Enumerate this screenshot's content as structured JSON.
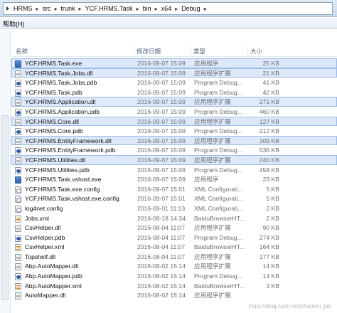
{
  "breadcrumb": [
    "HRMS",
    "src",
    "trunk",
    "YCF.HRMS.Task",
    "bin",
    "x64",
    "Debug"
  ],
  "menu": {
    "help": "帮助(H)"
  },
  "columns": {
    "name": "名称",
    "date": "修改日期",
    "type": "类型",
    "size": "大小"
  },
  "files": [
    {
      "name": "YCF.HRMS.Task.exe",
      "date": "2016-09-07 15:09",
      "type": "应用程序",
      "size": "25 KB",
      "icon": "exe",
      "selected": true
    },
    {
      "name": "YCF.HRMS.Task.Jobs.dll",
      "date": "2016-09-07 15:09",
      "type": "应用程序扩展",
      "size": "21 KB",
      "icon": "dll",
      "selected": true
    },
    {
      "name": "YCF.HRMS.Task.Jobs.pdb",
      "date": "2016-09-07 15:09",
      "type": "Program Debug...",
      "size": "41 KB",
      "icon": "pdb",
      "selected": false
    },
    {
      "name": "YCF.HRMS.Task.pdb",
      "date": "2016-09-07 15:09",
      "type": "Program Debug...",
      "size": "42 KB",
      "icon": "pdb",
      "selected": false
    },
    {
      "name": "YCF.HRMS.Application.dll",
      "date": "2016-09-07 15:09",
      "type": "应用程序扩展",
      "size": "271 KB",
      "icon": "dll",
      "selected": true
    },
    {
      "name": "YCF.HRMS.Application.pdb",
      "date": "2016-09-07 15:09",
      "type": "Program Debug...",
      "size": "460 KB",
      "icon": "pdb",
      "selected": false
    },
    {
      "name": "YCF.HRMS.Core.dll",
      "date": "2016-09-07 15:09",
      "type": "应用程序扩展",
      "size": "127 KB",
      "icon": "dll",
      "selected": true
    },
    {
      "name": "YCF.HRMS.Core.pdb",
      "date": "2016-09-07 15:09",
      "type": "Program Debug...",
      "size": "212 KB",
      "icon": "pdb",
      "selected": false
    },
    {
      "name": "YCF.HRMS.EntityFramework.dll",
      "date": "2016-09-07 15:09",
      "type": "应用程序扩展",
      "size": "309 KB",
      "icon": "dll",
      "selected": true
    },
    {
      "name": "YCF.HRMS.EntityFramework.pdb",
      "date": "2016-09-07 15:09",
      "type": "Program Debug...",
      "size": "536 KB",
      "icon": "pdb",
      "selected": false
    },
    {
      "name": "YCF.HRMS.Utilities.dll",
      "date": "2016-09-07 15:09",
      "type": "应用程序扩展",
      "size": "240 KB",
      "icon": "dll",
      "selected": true
    },
    {
      "name": "YCF.HRMS.Utilities.pdb",
      "date": "2016-09-07 15:09",
      "type": "Program Debug...",
      "size": "458 KB",
      "icon": "pdb",
      "selected": false
    },
    {
      "name": "YCF.HRMS.Task.vshost.exe",
      "date": "2016-09-07 15:09",
      "type": "应用程序",
      "size": "23 KB",
      "icon": "exe",
      "selected": false
    },
    {
      "name": "YCF.HRMS.Task.exe.config",
      "date": "2016-09-07 15:01",
      "type": "XML Configurati...",
      "size": "5 KB",
      "icon": "config",
      "selected": false
    },
    {
      "name": "YCF.HRMS.Task.vshost.exe.config",
      "date": "2016-09-07 15:01",
      "type": "XML Configurati...",
      "size": "5 KB",
      "icon": "config",
      "selected": false
    },
    {
      "name": "log4net.config",
      "date": "2016-09-01 11:13",
      "type": "XML Configurati...",
      "size": "2 KB",
      "icon": "config",
      "selected": false
    },
    {
      "name": "Jobs.xml",
      "date": "2016-08-18 14:34",
      "type": "BaiduBrowserHT...",
      "size": "2 KB",
      "icon": "xml",
      "selected": false
    },
    {
      "name": "CsvHelper.dll",
      "date": "2016-08-04 11:07",
      "type": "应用程序扩展",
      "size": "90 KB",
      "icon": "dll",
      "selected": false
    },
    {
      "name": "CsvHelper.pdb",
      "date": "2016-08-04 11:07",
      "type": "Program Debug...",
      "size": "274 KB",
      "icon": "pdb",
      "selected": false
    },
    {
      "name": "CsvHelper.xml",
      "date": "2016-08-04 11:07",
      "type": "BaiduBrowserHT...",
      "size": "164 KB",
      "icon": "xml",
      "selected": false
    },
    {
      "name": "Topshelf.dll",
      "date": "2016-08-04 11:07",
      "type": "应用程序扩展",
      "size": "177 KB",
      "icon": "dll",
      "selected": false
    },
    {
      "name": "Abp.AutoMapper.dll",
      "date": "2016-08-02 15:14",
      "type": "应用程序扩展",
      "size": "14 KB",
      "icon": "dll",
      "selected": false
    },
    {
      "name": "Abp.AutoMapper.pdb",
      "date": "2016-08-02 15:14",
      "type": "Program Debug...",
      "size": "14 KB",
      "icon": "pdb",
      "selected": false
    },
    {
      "name": "Abp.AutoMapper.xml",
      "date": "2016-08-02 15:14",
      "type": "BaiduBrowserHT...",
      "size": "3 KB",
      "icon": "xml",
      "selected": false
    },
    {
      "name": "AutoMapper.dll",
      "date": "2016-08-02 15:14",
      "type": "应用程序扩展",
      "size": "",
      "icon": "dll",
      "selected": false
    }
  ],
  "watermark": "https://blog.csdn.net/chaolen_jak"
}
